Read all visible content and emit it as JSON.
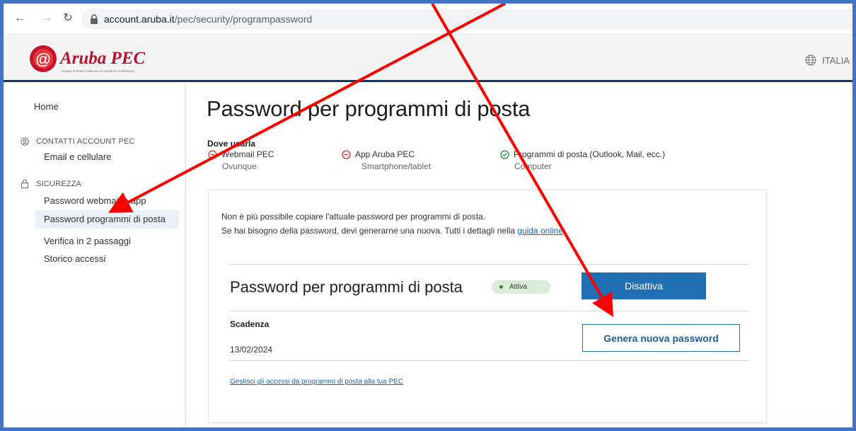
{
  "browser": {
    "url_host": "account.aruba.it",
    "url_path": "/pec/security/programpassword"
  },
  "header": {
    "logo_text": "Aruba PEC",
    "logo_tagline": "Gestore di Posta Certificata ed Autorità di Certificazione",
    "language": "ITALIA"
  },
  "sidebar": {
    "home": "Home",
    "section_contacts": "CONTATTI ACCOUNT PEC",
    "contacts_items": [
      "Email e cellulare"
    ],
    "section_security": "SICUREZZA",
    "security_items": [
      "Password webmail e app",
      "Password programmi di posta",
      "Verifica in 2 passaggi",
      "Storico accessi"
    ],
    "active_item": "Password programmi di posta"
  },
  "main": {
    "title": "Password per programmi di posta",
    "where_label": "Dove usarla",
    "usage": [
      {
        "name": "Webmail PEC",
        "where": "Ovunque",
        "status": "disabled"
      },
      {
        "name": "App Aruba PEC",
        "where": "Smartphone/tablet",
        "status": "disabled"
      },
      {
        "name": "Programmi di posta (Outlook, Mail, ecc.)",
        "where": "Computer",
        "status": "enabled"
      }
    ],
    "info_line1": "Non è più possibile copiare l'attuale password per programmi di posta.",
    "info_line2": "Se hai bisogno della password, devi generarne una nuova. Tutti i dettagli nella ",
    "info_link": "guida online",
    "info_line2_end": ".",
    "card_title": "Password per programmi di posta",
    "status_badge": "Attiva",
    "deactivate_button": "Disattiva",
    "expiry_label": "Scadenza",
    "expiry_value": "13/02/2024",
    "generate_button": "Genera nuova password",
    "manage_link": "Gestisci gli accessi da programmi di posta alla tua PEC"
  },
  "colors": {
    "frame": "#4472c4",
    "primary": "#1f6fb5",
    "header_border": "#0b3a68",
    "active_badge": "#d8ecd8",
    "annotation_arrow": "#ff0000",
    "disabled_icon": "#d32f2f",
    "enabled_icon": "#2b8a3e"
  }
}
